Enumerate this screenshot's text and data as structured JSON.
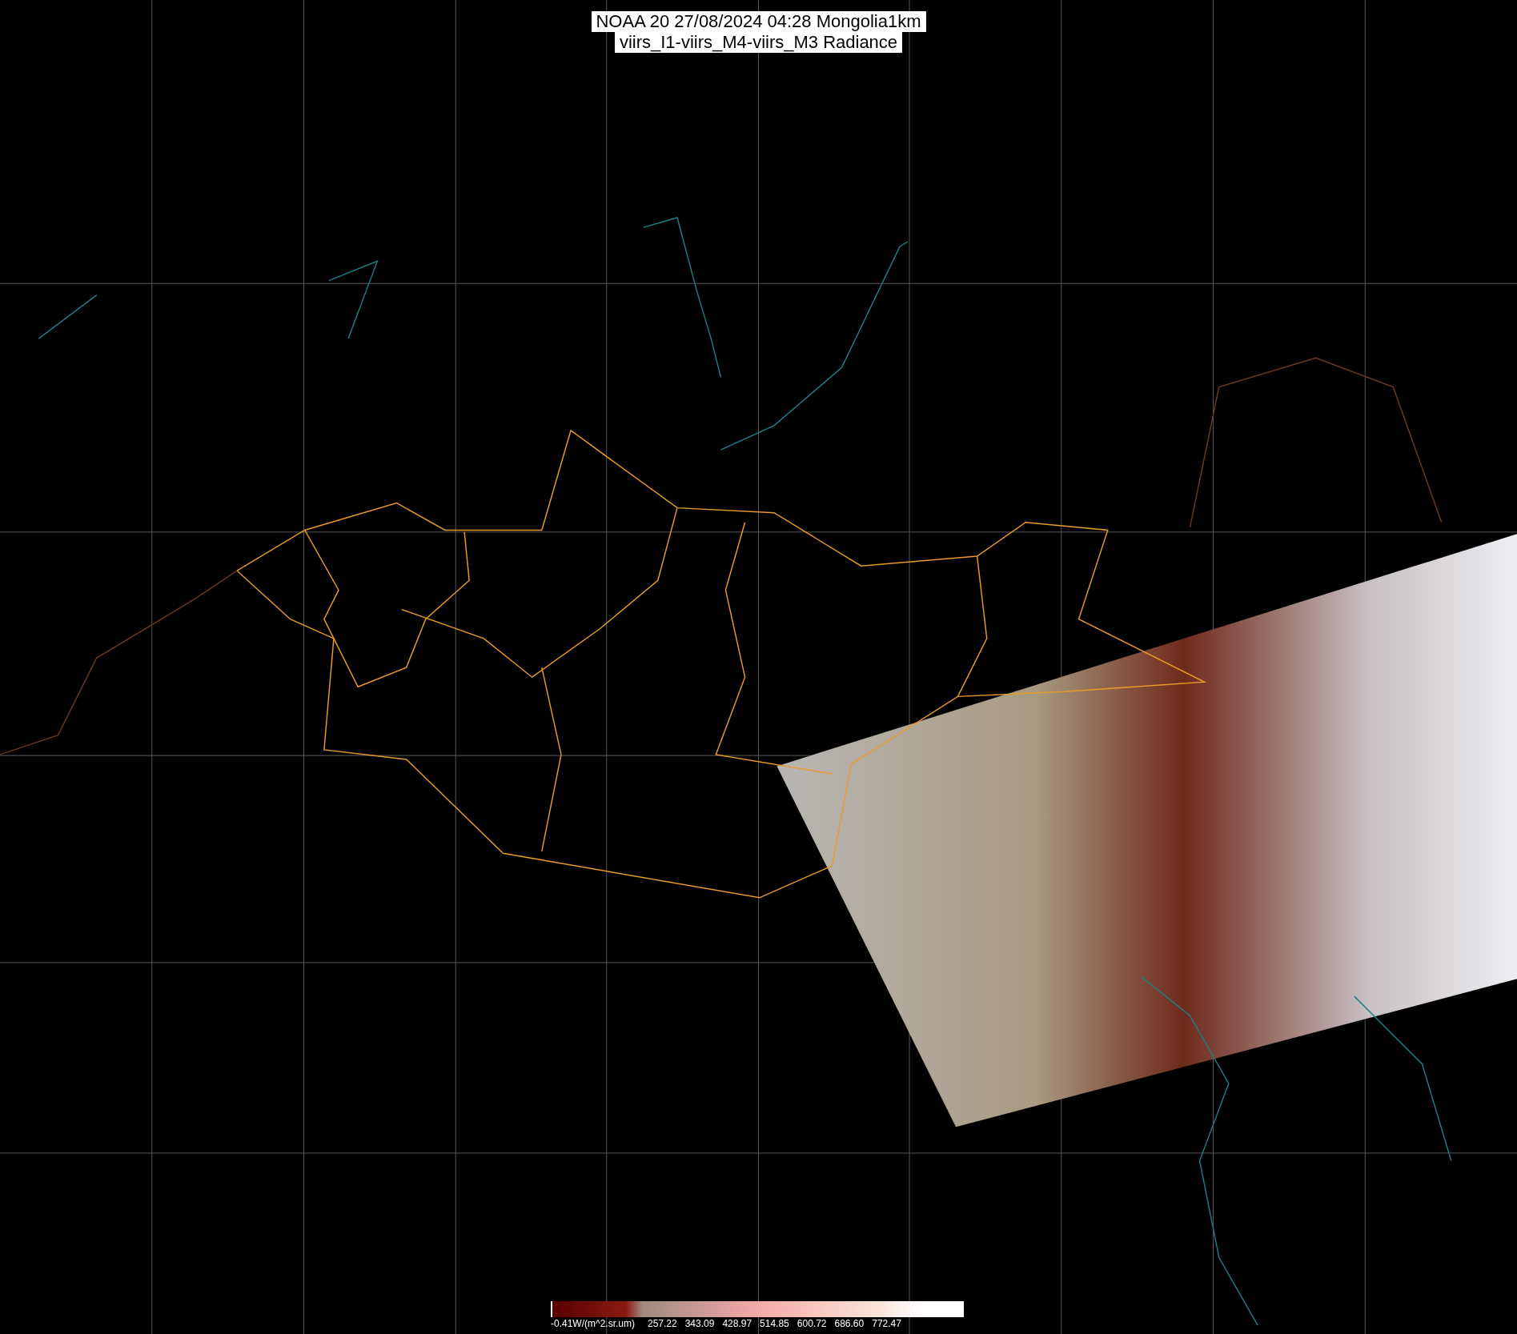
{
  "title": {
    "lines": [
      "NOAA 20 27/08/2024 04:28 Mongolia1km",
      "viirs_I1-viirs_M4-viirs_M3 Radiance"
    ]
  },
  "legend": {
    "labels": [
      "-0.41W/(m^2.sr.um)",
      "257.22",
      "343.09",
      "428.97",
      "514.85",
      "600.72",
      "686.60",
      "772.47"
    ]
  }
}
